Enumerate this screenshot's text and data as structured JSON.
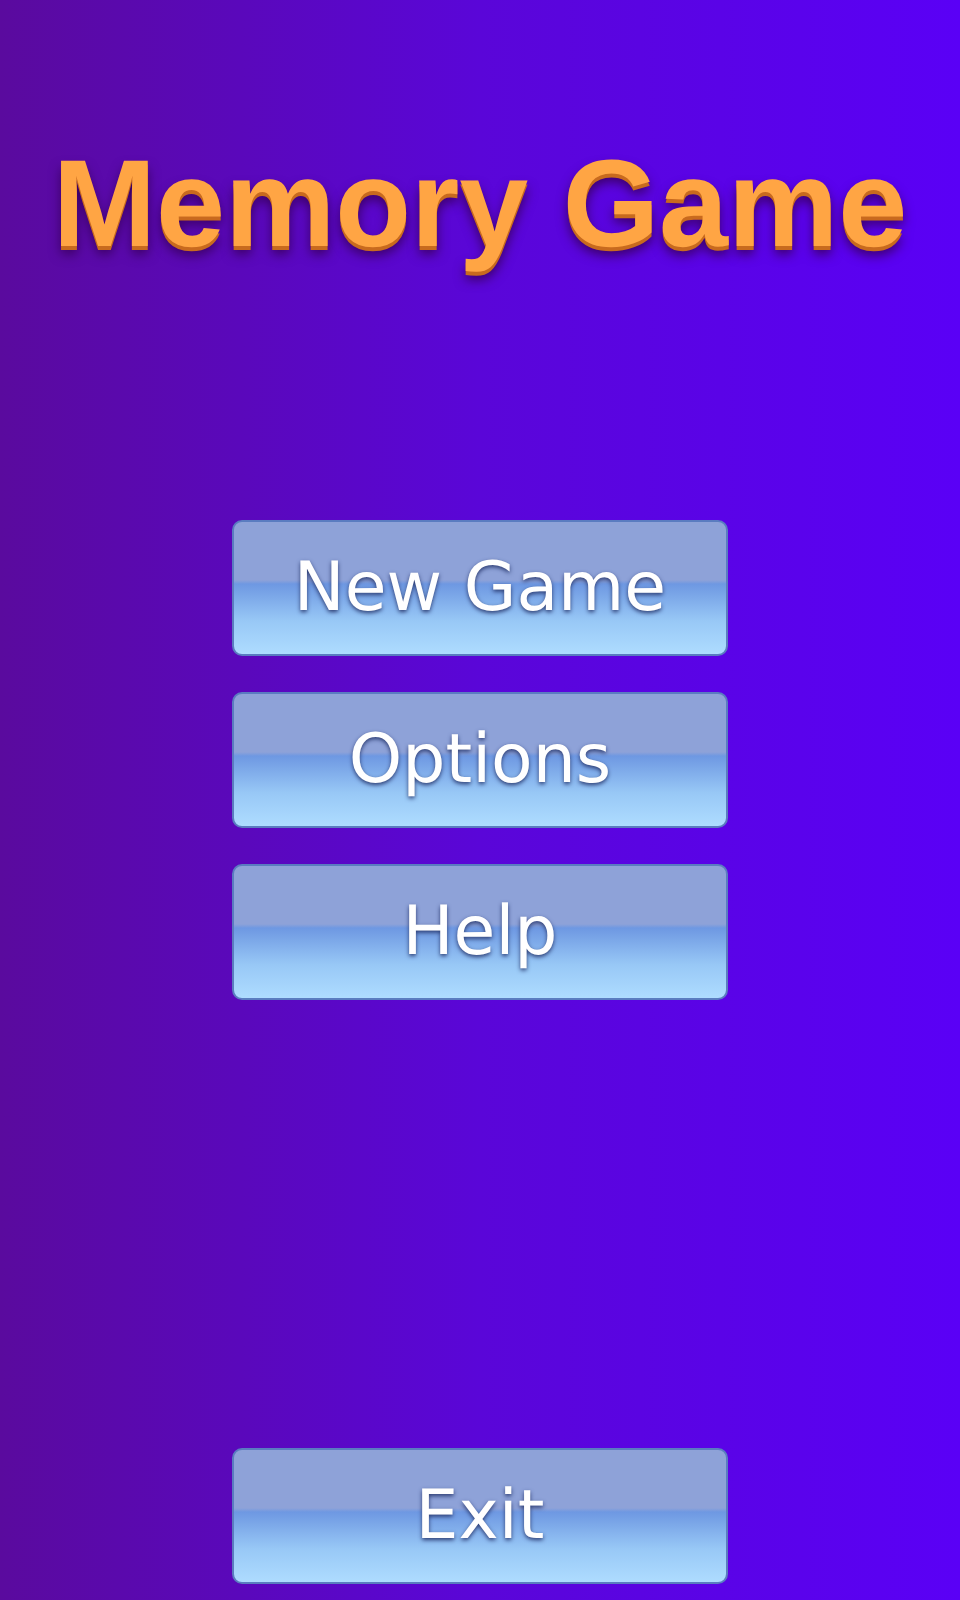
{
  "title": "Memory Game",
  "menu": [
    {
      "label": "New Game"
    },
    {
      "label": "Options"
    },
    {
      "label": "Help"
    }
  ],
  "exit": {
    "label": "Exit"
  }
}
